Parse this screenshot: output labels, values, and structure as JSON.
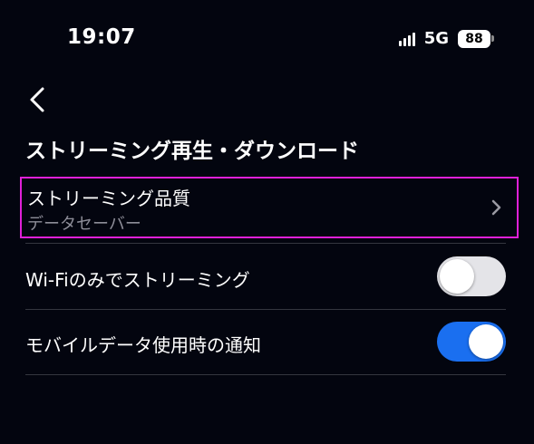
{
  "status_bar": {
    "time": "19:07",
    "network": "5G",
    "battery": "88"
  },
  "header": {
    "back_icon": "chevron-left-icon",
    "section_title": "ストリーミング再生・ダウンロード"
  },
  "settings": {
    "streaming_quality": {
      "label": "ストリーミング品質",
      "value": "データセーバー"
    },
    "wifi_only": {
      "label": "Wi-Fiのみでストリーミング",
      "enabled": false
    },
    "mobile_data_notice": {
      "label": "モバイルデータ使用時の通知",
      "enabled": true
    }
  },
  "colors": {
    "background": "#03050f",
    "highlight": "#e020d8",
    "toggle_on": "#1a6ff0",
    "toggle_off": "#e4e4e8"
  }
}
